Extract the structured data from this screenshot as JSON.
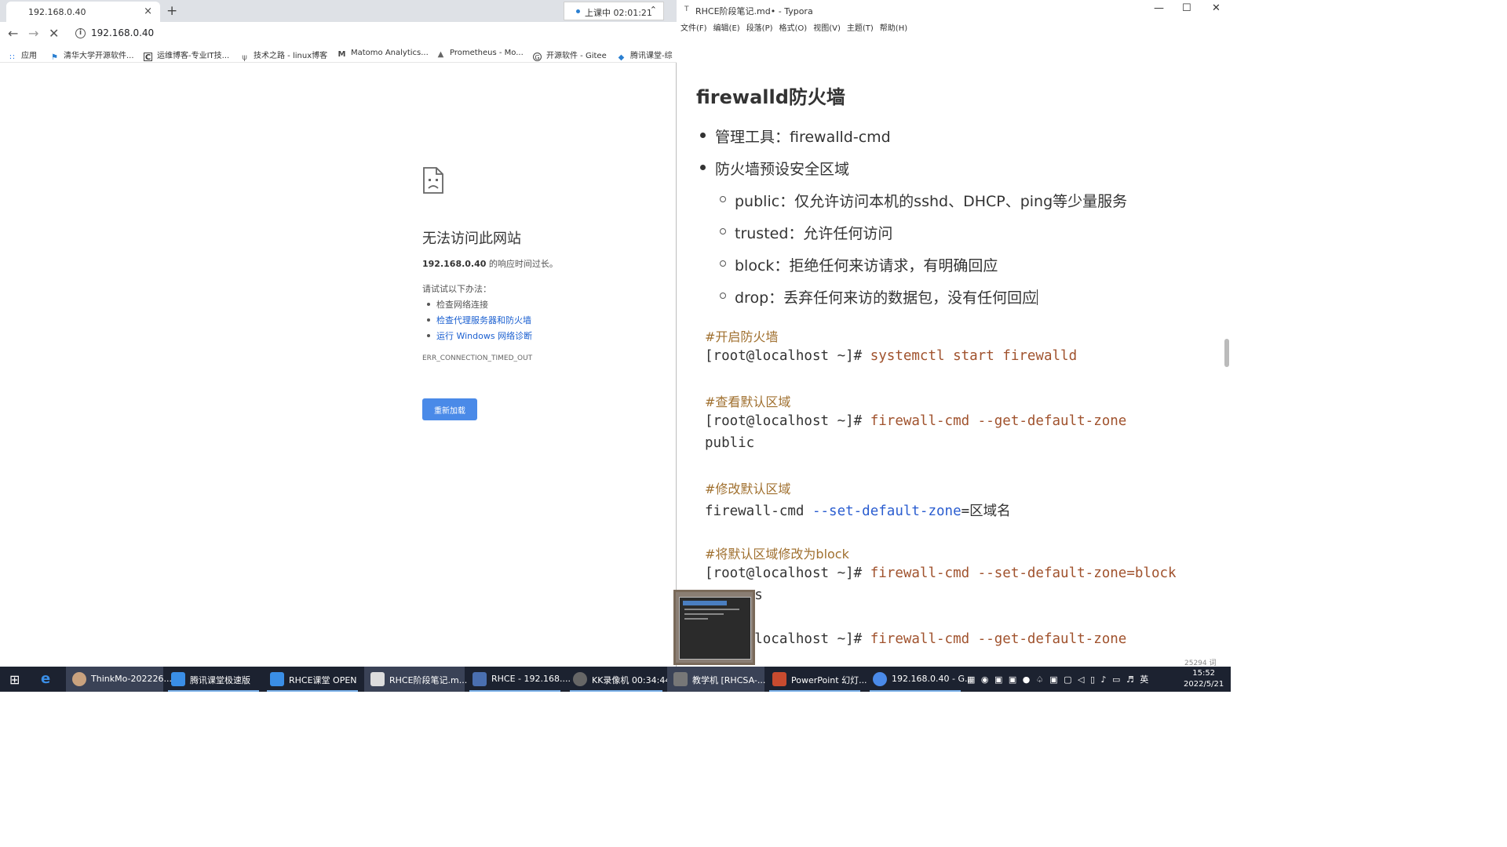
{
  "browser": {
    "tab_title": "192.168.0.40",
    "tab_close": "×",
    "new_tab": "+",
    "class_timer": "上课中 02:01:21",
    "url": "192.168.0.40",
    "bookmarks": [
      {
        "label": "应用",
        "icon": "apps-grid-icon"
      },
      {
        "label": "清华大学开源软件...",
        "icon": "tsinghua-icon"
      },
      {
        "label": "运维博客-专业IT技...",
        "icon": "blog-c-icon"
      },
      {
        "label": "技术之路 - linux博客",
        "icon": "bookmark-icon"
      },
      {
        "label": "Matomo Analytics...",
        "icon": "matomo-icon"
      },
      {
        "label": "Prometheus - Mo...",
        "icon": "prometheus-icon"
      },
      {
        "label": "开源软件 - Gitee",
        "icon": "gitee-icon"
      },
      {
        "label": "腾讯课堂-综",
        "icon": "tencent-class-icon"
      }
    ],
    "error": {
      "title": "无法访问此网站",
      "host": "192.168.0.40",
      "desc_suffix": " 的响应时间过长。",
      "try_label": "请试试以下办法：",
      "suggestions": [
        "检查网络连接",
        "检查代理服务器和防火墙",
        "运行 Windows 网络诊断"
      ],
      "code": "ERR_CONNECTION_TIMED_OUT",
      "reload": "重新加载"
    }
  },
  "typora": {
    "title": "RHCE阶段笔记.md• - Typora",
    "menu": [
      "文件(F)",
      "编辑(E)",
      "段落(P)",
      "格式(O)",
      "视图(V)",
      "主题(T)",
      "帮助(H)"
    ],
    "heading": "firewalld防火墙",
    "bullets": [
      "管理工具：firewalld-cmd",
      "防火墙预设安全区域"
    ],
    "zones": [
      "public：仅允许访问本机的sshd、DHCP、ping等少量服务",
      "trusted：允许任何访问",
      "block：拒绝任何来访请求，有明确回应",
      "drop：丢弃任何来访的数据包，没有任何回应"
    ],
    "code": {
      "c1": "#开启防火墙",
      "p1": "[root@localhost ~]# ",
      "k1": "systemctl start firewalld",
      "c2": "#查看默认区域",
      "p2": "[root@localhost ~]# ",
      "k2": "firewall-cmd --get-default-zone",
      "o2": "public",
      "c3": "#修改默认区域",
      "k3a": "firewall-cmd ",
      "k3b": "--set-default-zone",
      "k3c": "=区域名",
      "c4": "#将默认区域修改为block",
      "p4": "[root@localhost ~]# ",
      "k4": "firewall-cmd --set-default-zone=block",
      "o4": "success",
      "p5": "[root@localhost ~]# ",
      "k5": "firewall-cmd --get-default-zone"
    },
    "word_count": "25294 词"
  },
  "taskbar": {
    "items": [
      {
        "label": "ThinkMo-202226...",
        "state": "active",
        "color": "#c9a27e"
      },
      {
        "label": "腾讯课堂极速版",
        "state": "open",
        "color": "#3a8ee6"
      },
      {
        "label": "RHCE课堂 OPEN",
        "state": "open",
        "color": "#3a8ee6"
      },
      {
        "label": "RHCE阶段笔记.m...",
        "state": "active",
        "color": "#dddddd"
      },
      {
        "label": "RHCE - 192.168....",
        "state": "open",
        "color": "#4a6fb0"
      },
      {
        "label": "KK录像机 00:34:44",
        "state": "open",
        "color": "#666666"
      },
      {
        "label": "教学机 [RHCSA-...",
        "state": "active",
        "color": "#777777"
      },
      {
        "label": "PowerPoint 幻灯...",
        "state": "open",
        "color": "#c84b2f"
      },
      {
        "label": "192.168.0.40 - G...",
        "state": "open",
        "color": "#4a8ae8"
      }
    ],
    "ime": "英",
    "time": "15:52",
    "date": "2022/5/21"
  }
}
